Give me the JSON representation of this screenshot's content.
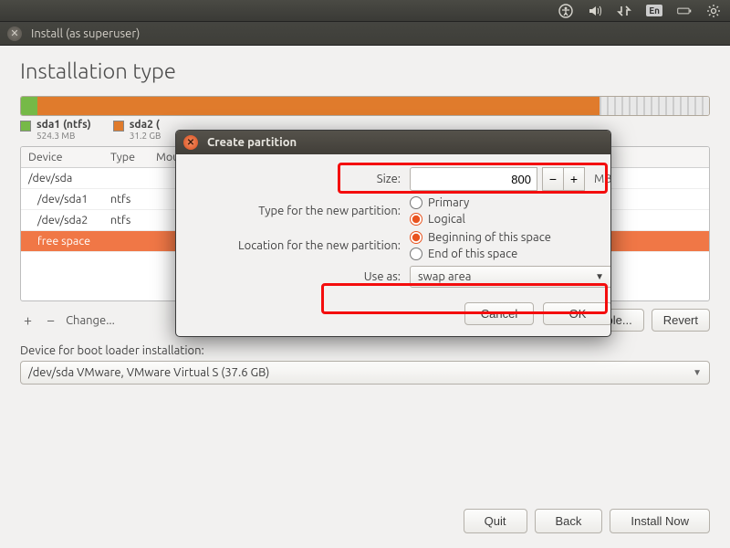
{
  "menubar": {
    "lang": "En"
  },
  "window": {
    "title": "Install (as superuser)"
  },
  "page": {
    "title": "Installation type"
  },
  "legend": {
    "p1": {
      "name": "sda1 (ntfs)",
      "size": "524.3 MB"
    },
    "p2": {
      "name": "sda2 (",
      "size": "31.2 GB"
    }
  },
  "table": {
    "headers": {
      "device": "Device",
      "type": "Type",
      "mount": "Mour"
    },
    "rows": [
      {
        "device": "/dev/sda",
        "type": "",
        "selected": false,
        "sub": false
      },
      {
        "device": "/dev/sda1",
        "type": "ntfs",
        "selected": false,
        "sub": true
      },
      {
        "device": "/dev/sda2",
        "type": "ntfs",
        "selected": false,
        "sub": true
      },
      {
        "device": "free space",
        "type": "",
        "selected": true,
        "sub": true
      }
    ]
  },
  "toolbar": {
    "change": "Change...",
    "new_table": "New Partition Table...",
    "revert": "Revert"
  },
  "bootloader": {
    "label": "Device for boot loader installation:",
    "selected": "/dev/sda   VMware, VMware Virtual S (37.6 GB)"
  },
  "bottom": {
    "quit": "Quit",
    "back": "Back",
    "install": "Install Now"
  },
  "dialog": {
    "title": "Create partition",
    "size_label": "Size:",
    "size_value": "800",
    "size_unit": "MB",
    "type_label": "Type for the new partition:",
    "type_primary": "Primary",
    "type_logical": "Logical",
    "loc_label": "Location for the new partition:",
    "loc_begin": "Beginning of this space",
    "loc_end": "End of this space",
    "useas_label": "Use as:",
    "useas_value": "swap area",
    "cancel": "Cancel",
    "ok": "OK"
  }
}
